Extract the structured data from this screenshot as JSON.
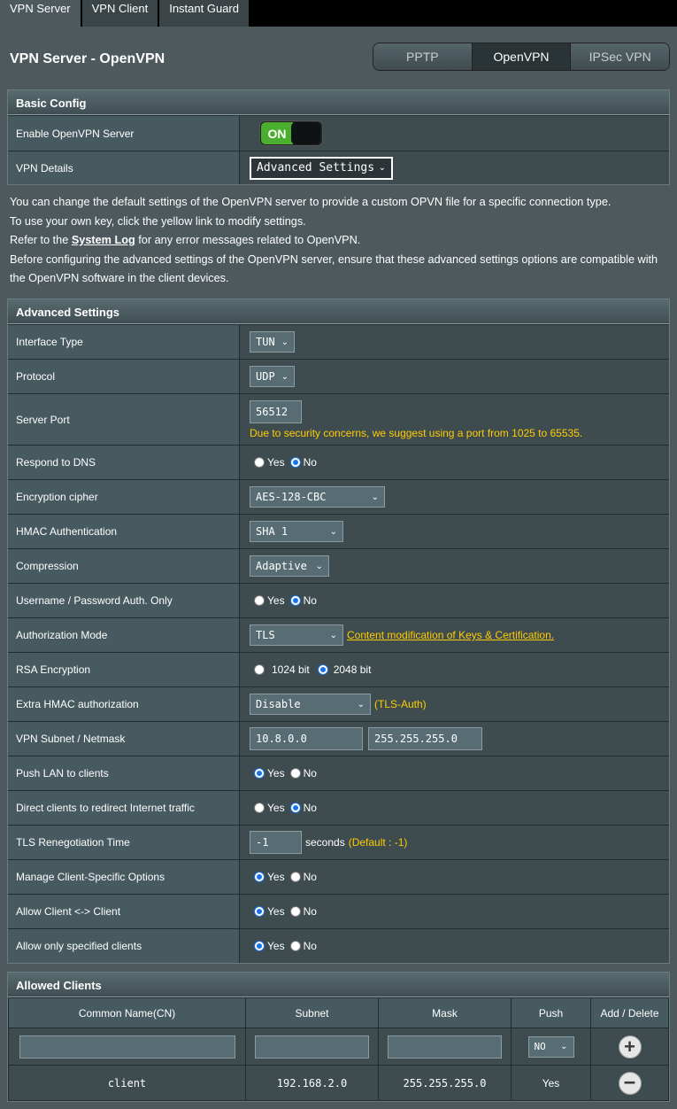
{
  "tabs": [
    "VPN Server",
    "VPN Client",
    "Instant Guard"
  ],
  "page_title": "VPN Server - OpenVPN",
  "segments": [
    "PPTP",
    "OpenVPN",
    "IPSec VPN"
  ],
  "basic": {
    "title": "Basic Config",
    "enable_label": "Enable OpenVPN Server",
    "toggle_on": "ON",
    "details_label": "VPN Details",
    "details_value": "Advanced Settings"
  },
  "desc": {
    "line1": "You can change the default settings of the OpenVPN server to provide a custom OPVN file for a specific connection type.",
    "line2": "To use your own key, click the yellow link to modify settings.",
    "line3_pre": "Refer to the ",
    "line3_link": "System Log",
    "line3_post": " for any error messages related to OpenVPN.",
    "line4": "Before configuring the advanced settings of the OpenVPN server, ensure that these advanced settings options are compatible with the OpenVPN software in the client devices."
  },
  "adv": {
    "title": "Advanced Settings",
    "interface_label": "Interface Type",
    "interface_value": "TUN",
    "protocol_label": "Protocol",
    "protocol_value": "UDP",
    "port_label": "Server Port",
    "port_value": "56512",
    "port_hint": "Due to security concerns, we suggest using a port from 1025 to 65535.",
    "dns_label": "Respond to DNS",
    "cipher_label": "Encryption cipher",
    "cipher_value": "AES-128-CBC",
    "hmac_label": "HMAC Authentication",
    "hmac_value": "SHA 1",
    "comp_label": "Compression",
    "comp_value": "Adaptive",
    "userpass_label": "Username / Password Auth. Only",
    "authmode_label": "Authorization Mode",
    "authmode_value": "TLS",
    "authmode_link": "Content modification of Keys & Certification.",
    "rsa_label": "RSA Encryption",
    "rsa_1024": "1024 bit",
    "rsa_2048": "2048 bit",
    "extra_hmac_label": "Extra HMAC authorization",
    "extra_hmac_value": "Disable",
    "extra_hmac_hint": "(TLS-Auth)",
    "subnet_label": "VPN Subnet / Netmask",
    "subnet_value": "10.8.0.0",
    "netmask_value": "255.255.255.0",
    "pushlan_label": "Push LAN to clients",
    "redirect_label": "Direct clients to redirect Internet traffic",
    "tls_label": "TLS Renegotiation Time",
    "tls_value": "-1",
    "tls_unit": "seconds",
    "tls_hint": "(Default : -1)",
    "manage_label": "Manage Client-Specific Options",
    "c2c_label": "Allow Client <-> Client",
    "only_label": "Allow only specified clients"
  },
  "radio": {
    "yes": "Yes",
    "no": "No"
  },
  "clients": {
    "title": "Allowed Clients",
    "headers": [
      "Common Name(CN)",
      "Subnet",
      "Mask",
      "Push",
      "Add / Delete"
    ],
    "push_select": "NO",
    "row": {
      "cn": "client",
      "subnet": "192.168.2.0",
      "mask": "255.255.255.0",
      "push": "Yes"
    }
  }
}
